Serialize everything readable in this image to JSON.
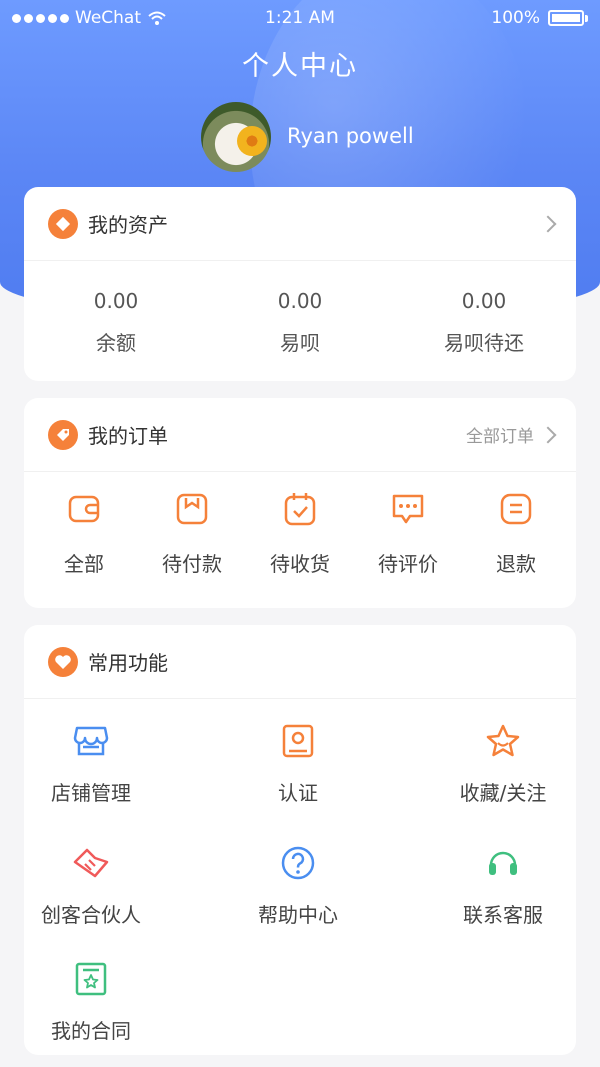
{
  "status_bar": {
    "carrier": "WeChat",
    "time": "1:21 AM",
    "battery": "100%"
  },
  "header": {
    "title": "个人中心",
    "username": "Ryan powell"
  },
  "assets": {
    "title": "我的资产",
    "items": [
      {
        "value": "0.00",
        "label": "余额"
      },
      {
        "value": "0.00",
        "label": "易呗"
      },
      {
        "value": "0.00",
        "label": "易呗待还"
      }
    ]
  },
  "orders": {
    "title": "我的订单",
    "more_label": "全部订单",
    "items": [
      {
        "label": "全部",
        "icon": "wallet-icon"
      },
      {
        "label": "待付款",
        "icon": "payment-icon"
      },
      {
        "label": "待收货",
        "icon": "calendar-check-icon"
      },
      {
        "label": "待评价",
        "icon": "comment-icon"
      },
      {
        "label": "退款",
        "icon": "refund-icon"
      }
    ]
  },
  "functions": {
    "title": "常用功能",
    "items": [
      {
        "label": "店铺管理",
        "icon": "store-icon"
      },
      {
        "label": "认证",
        "icon": "id-card-icon"
      },
      {
        "label": "收藏/关注",
        "icon": "star-icon"
      },
      {
        "label": "创客合伙人",
        "icon": "handshake-icon"
      },
      {
        "label": "帮助中心",
        "icon": "help-icon"
      },
      {
        "label": "联系客服",
        "icon": "headset-icon"
      },
      {
        "label": "我的合同",
        "icon": "contract-icon"
      }
    ]
  },
  "colors": {
    "accent": "#f5813a",
    "header_bg": "#5b86f5",
    "blue_icon": "#4a8ef0",
    "green_icon": "#3fbf7f",
    "red_icon": "#f05a5a"
  }
}
